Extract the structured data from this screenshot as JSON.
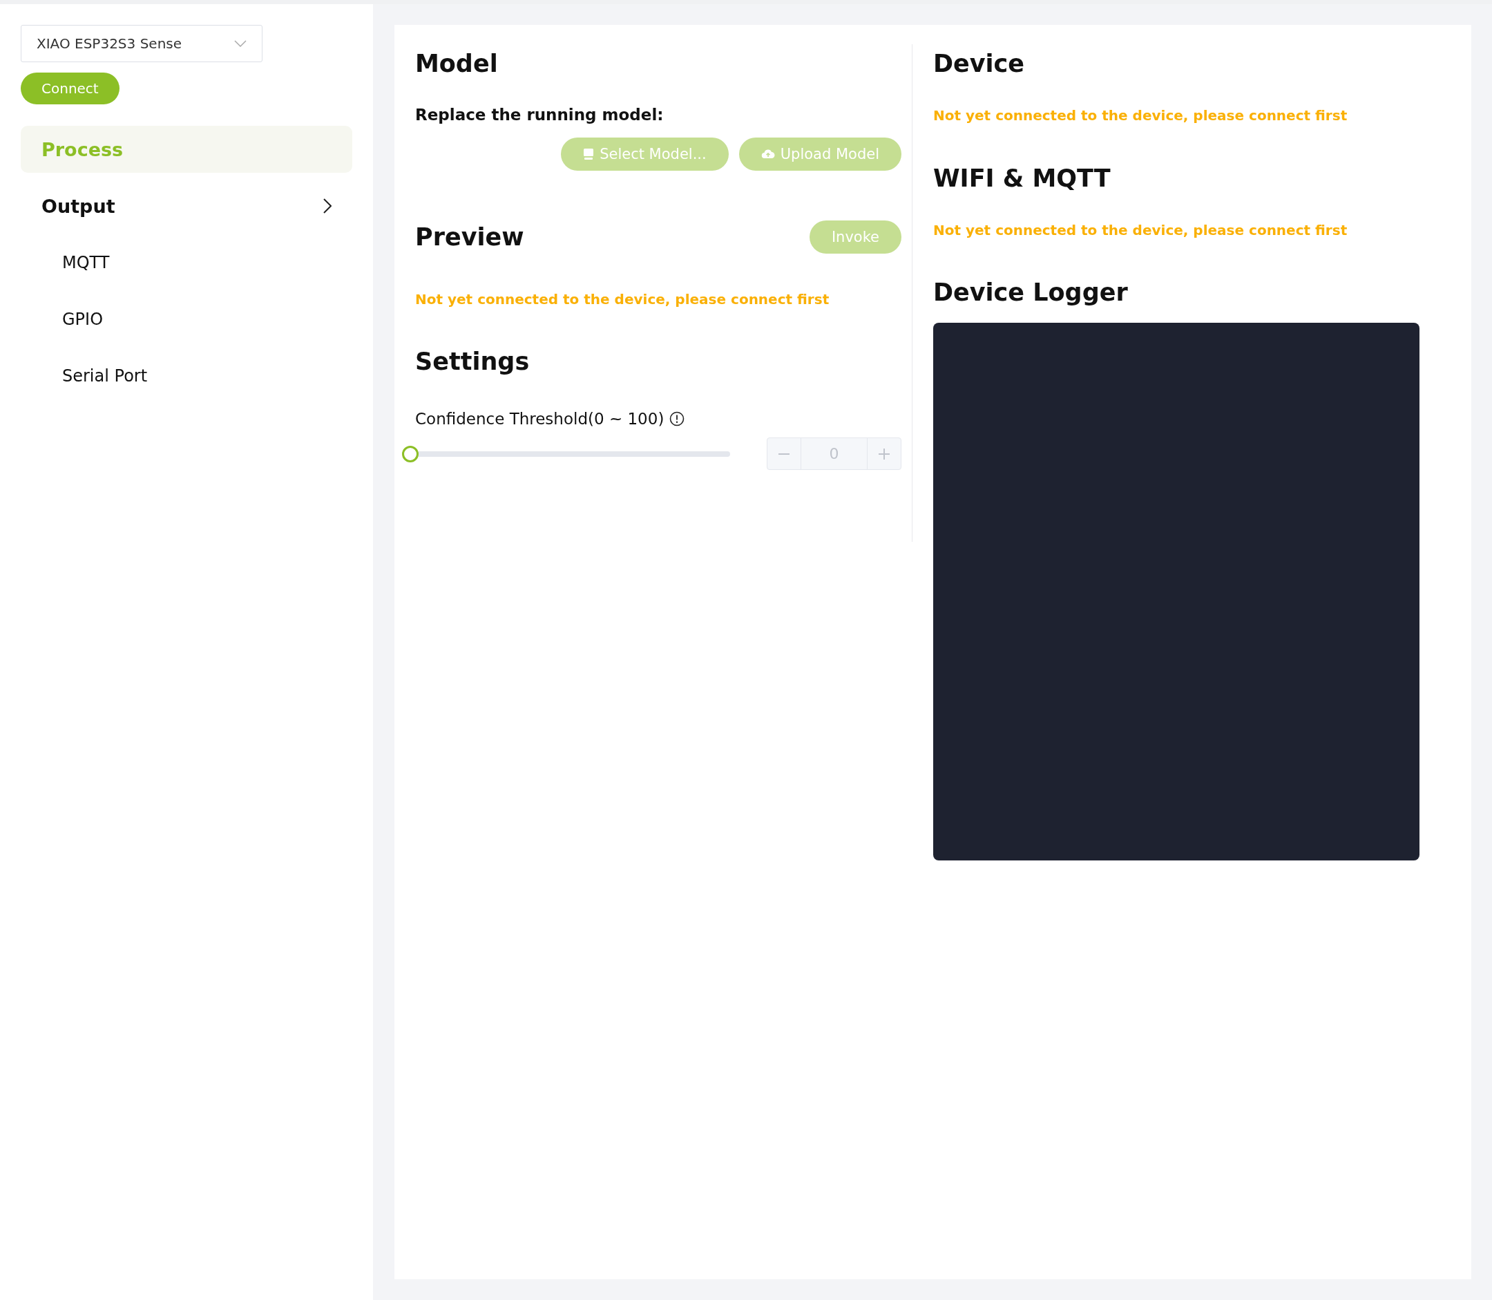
{
  "sidebar": {
    "device_select": {
      "value": "XIAO ESP32S3 Sense"
    },
    "connect_button": {
      "label": "Connect",
      "disabled": false
    },
    "items": [
      {
        "label": "Process",
        "selected": true
      },
      {
        "label": "Output",
        "selected": false,
        "children": [
          {
            "label": "MQTT",
            "selected": false
          },
          {
            "label": "GPIO",
            "selected": false
          },
          {
            "label": "Serial Port",
            "selected": false
          }
        ]
      }
    ]
  },
  "model": {
    "title": "Model",
    "label": "Replace the running model:",
    "buttons": [
      {
        "label": "Select Model...",
        "kind": "select",
        "disabled": true
      },
      {
        "label": "Upload Model",
        "kind": "upload",
        "disabled": true
      }
    ]
  },
  "preview": {
    "title": "Preview",
    "invoke_button": {
      "label": "Invoke",
      "disabled": true
    },
    "warning": "Not yet connected to the device, please connect first"
  },
  "settings": {
    "title": "Settings",
    "confidence": {
      "label": "Confidence Threshold(0 ~ 100)",
      "level": 0,
      "value": "0",
      "disabled": true
    }
  },
  "device": {
    "title": "Device",
    "warning": "Not yet connected to the device, please connect first"
  },
  "wifi_mqtt": {
    "title": "WIFI & MQTT",
    "warning": "Not yet connected to the device, please connect first"
  },
  "device_logger": {
    "title": "Device Logger"
  }
}
